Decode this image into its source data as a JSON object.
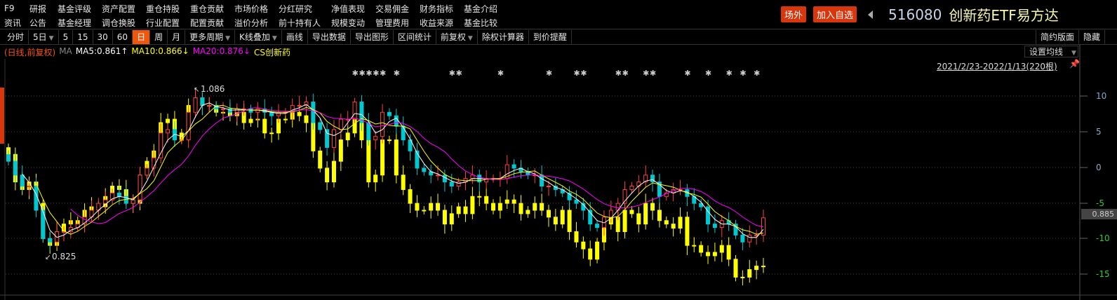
{
  "menu_row1": [
    "F9",
    "研报",
    "基金评级",
    "资产配置",
    "重仓持股",
    "重仓贡献",
    "市场价格",
    "分红研究",
    "净值表现",
    "交易佣金",
    "财务指标",
    "基金介绍"
  ],
  "menu_row2": [
    "资讯",
    "公告",
    "基金经理",
    "调仓换股",
    "行业配置",
    "配置贡献",
    "溢价分析",
    "前十持有人",
    "规模变动",
    "管理费用",
    "收益来源",
    "基金比较"
  ],
  "header": {
    "offsite_label": "场外",
    "add_watch_label": "加入自选",
    "code": "516080",
    "name": "创新药ETF易方达"
  },
  "toolbar": [
    {
      "label": "分时"
    },
    {
      "label": "5日",
      "dropdown": true
    },
    {
      "label": "5"
    },
    {
      "label": "15"
    },
    {
      "label": "30"
    },
    {
      "label": "60"
    },
    {
      "label": "日",
      "active": true
    },
    {
      "label": "周"
    },
    {
      "label": "月"
    },
    {
      "label": "更多周期",
      "dropdown": true
    },
    {
      "label": "K线叠加",
      "dropdown": true
    },
    {
      "label": "画线"
    },
    {
      "label": "导出数据"
    },
    {
      "label": "导出图形"
    },
    {
      "label": "区间统计"
    },
    {
      "label": "前复权",
      "dropdown": true
    },
    {
      "label": "除权计算器"
    },
    {
      "label": "到价提醒"
    }
  ],
  "toolbar_right": [
    "简约版面",
    "隐藏"
  ],
  "legend": {
    "mode": "(日线,前复权)",
    "ma": "MA",
    "ma5": "MA5:0.861↑",
    "ma10": "MA10:0.866↓",
    "ma20": "MA20:0.876↓",
    "overlay": "CS创新药"
  },
  "set_ma_label": "设置均线",
  "range_label": "2021/2/23-2022/1/13(220根)",
  "current_price": "0.885",
  "colors": {
    "up": "#ff4040",
    "down": "#00c8d0",
    "overlay": "#ffff00",
    "ma5": "#ffffff",
    "ma10": "#ffff00",
    "ma20": "#ff00ff",
    "accent": "#f2560c"
  },
  "chart_data": {
    "type": "candlestick",
    "title": "516080 创新药ETF易方达",
    "bars": 220,
    "high_label": "1.086",
    "low_label": "0.825",
    "high_value": 1.086,
    "low_value": 0.825,
    "right_axis_ticks": [
      "10",
      "5",
      "0",
      "-5",
      "-10",
      "-15"
    ],
    "etf_close": [
      0.967,
      0.947,
      0.931,
      0.931,
      0.896,
      0.855,
      0.85,
      0.865,
      0.865,
      0.871,
      0.876,
      0.886,
      0.896,
      0.906,
      0.911,
      0.921,
      0.916,
      0.906,
      0.911,
      0.947,
      0.957,
      0.972,
      1.008,
      1.013,
      0.998,
      0.998,
      1.038,
      1.059,
      1.048,
      1.048,
      1.043,
      1.043,
      1.038,
      1.043,
      1.043,
      1.038,
      1.043,
      1.038,
      1.033,
      1.038,
      1.038,
      1.048,
      1.048,
      1.053,
      1.023,
      1.013,
      0.987,
      1.013,
      1.028,
      1.028,
      1.053,
      1.023,
      0.998,
      1.003,
      1.038,
      1.033,
      1.018,
      0.998,
      0.982,
      0.957,
      0.952,
      0.947,
      0.947,
      0.937,
      0.931,
      0.937,
      0.942,
      0.947,
      0.937,
      0.942,
      0.942,
      0.942,
      0.962,
      0.957,
      0.952,
      0.947,
      0.947,
      0.931,
      0.931,
      0.926,
      0.921,
      0.911,
      0.906,
      0.896,
      0.876,
      0.871,
      0.886,
      0.896,
      0.906,
      0.926,
      0.931,
      0.937,
      0.947,
      0.937,
      0.916,
      0.921,
      0.926,
      0.926,
      0.916,
      0.906,
      0.901,
      0.876,
      0.871,
      0.881,
      0.876,
      0.86,
      0.85,
      0.86,
      0.86,
      0.885
    ],
    "overlay_close": [
      0.977,
      0.937,
      0.926,
      0.937,
      0.906,
      0.855,
      0.845,
      0.865,
      0.876,
      0.881,
      0.876,
      0.896,
      0.901,
      0.901,
      0.916,
      0.931,
      0.926,
      0.911,
      0.906,
      0.947,
      0.967,
      0.982,
      1.023,
      1.028,
      0.998,
      1.008,
      1.048,
      1.059,
      1.048,
      1.048,
      1.038,
      1.038,
      1.033,
      1.038,
      1.023,
      1.028,
      1.028,
      1.008,
      1.008,
      1.028,
      1.028,
      1.038,
      1.033,
      1.023,
      0.982,
      0.957,
      0.937,
      0.967,
      0.998,
      1.008,
      1.038,
      0.998,
      0.937,
      0.947,
      0.998,
      0.998,
      0.947,
      0.926,
      0.906,
      0.896,
      0.896,
      0.906,
      0.896,
      0.876,
      0.891,
      0.901,
      0.891,
      0.916,
      0.916,
      0.906,
      0.896,
      0.906,
      0.911,
      0.906,
      0.891,
      0.896,
      0.906,
      0.896,
      0.886,
      0.876,
      0.896,
      0.865,
      0.85,
      0.84,
      0.825,
      0.85,
      0.876,
      0.886,
      0.865,
      0.896,
      0.891,
      0.876,
      0.906,
      0.896,
      0.881,
      0.876,
      0.87,
      0.886,
      0.845,
      0.845,
      0.835,
      0.83,
      0.835,
      0.845,
      0.825,
      0.799,
      0.799,
      0.81,
      0.815,
      0.815
    ],
    "event_marker_bars": [
      50,
      51,
      52,
      53,
      54,
      56,
      64,
      65,
      71,
      78,
      82,
      83,
      88,
      89,
      92,
      93,
      98,
      101,
      104,
      106,
      108
    ]
  }
}
